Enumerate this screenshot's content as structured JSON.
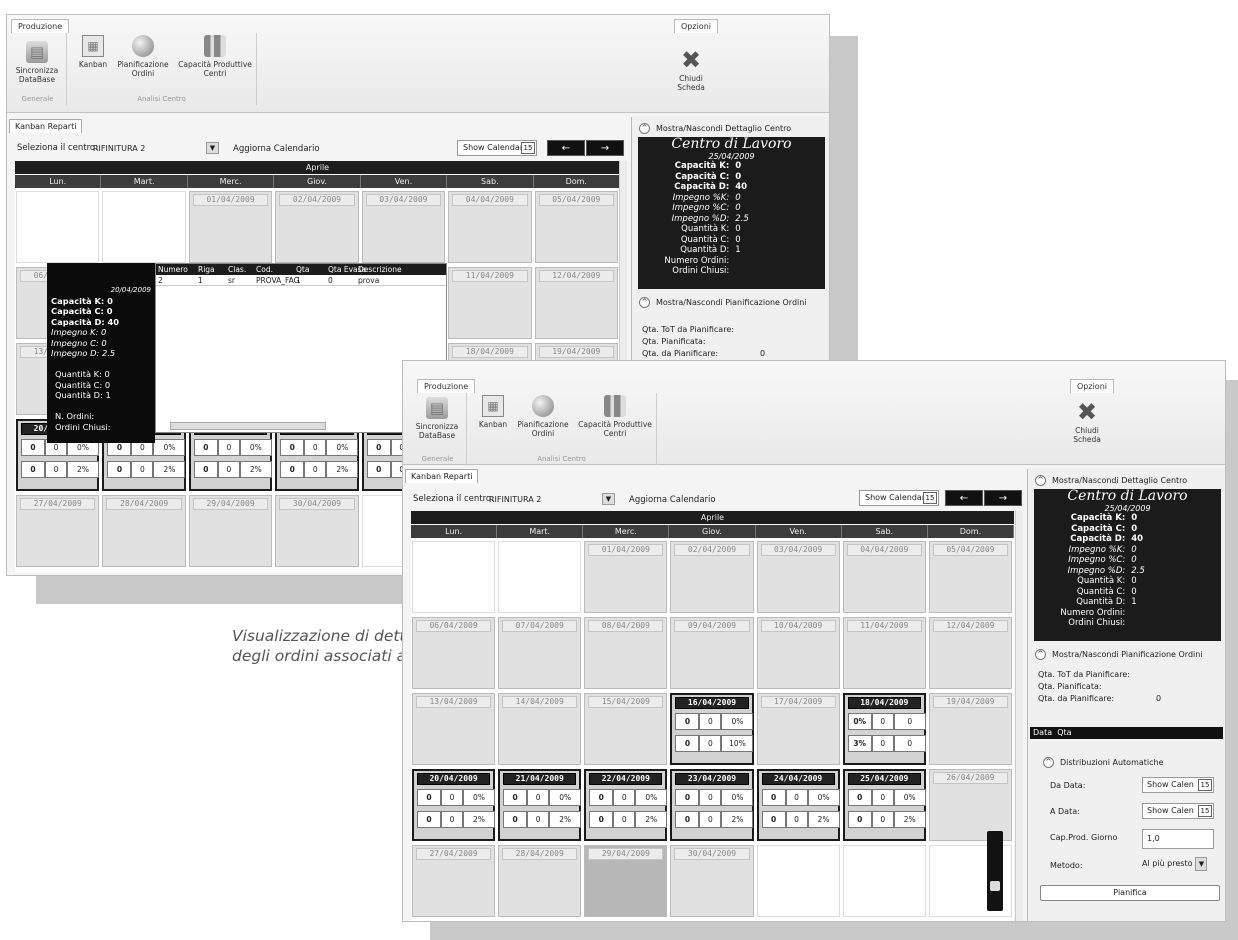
{
  "ribbon": {
    "tab_main": "Produzione",
    "tab_options": "Opzioni",
    "buttons": {
      "sync": "Sincronizza DataBase",
      "kanban": "Kanban",
      "plan": "Pianificazione Ordini",
      "cap": "Capacità Produttive Centri",
      "close": "Chiudi Scheda"
    },
    "groups": {
      "general": "Generale",
      "centri": "Analisi Centro"
    }
  },
  "kanban": {
    "tab": "Kanban Reparti",
    "select_label": "Seleziona il centro:",
    "select_value": "RIFINITURA 2",
    "update": "Aggiorna Calendario",
    "show_calendar": "Show Calendar",
    "cal_icon": "15",
    "prev": "←",
    "next": "→"
  },
  "calendar": {
    "month": "Aprile",
    "days": [
      "Lun.",
      "Mart.",
      "Merc.",
      "Giov.",
      "Ven.",
      "Sab.",
      "Dom."
    ],
    "weeks": [
      [
        "",
        "",
        "01/04/2009",
        "02/04/2009",
        "03/04/2009",
        "04/04/2009",
        "05/04/2009"
      ],
      [
        "06/04/2009",
        "07/04/2009",
        "08/04/2009",
        "09/04/2009",
        "10/04/2009",
        "11/04/2009",
        "12/04/2009"
      ],
      [
        "13/04/2009",
        "14/04/2009",
        "15/04/2009",
        "16/04/2009",
        "17/04/2009",
        "18/04/2009",
        "19/04/2009"
      ],
      [
        "20/04/2009",
        "21/04/2009",
        "22/04/2009",
        "23/04/2009",
        "24/04/2009",
        "25/04/2009",
        "26/04/2009"
      ],
      [
        "27/04/2009",
        "28/04/2009",
        "29/04/2009",
        "30/04/2009",
        "",
        "",
        ""
      ]
    ],
    "kanban_cells": {
      "16": [
        [
          "0",
          "0",
          "0%"
        ],
        [
          "0",
          "0",
          "10%"
        ]
      ],
      "18": [
        [
          "0%",
          "0",
          "0"
        ],
        [
          "3%",
          "0",
          "0"
        ]
      ],
      "std": [
        [
          "0",
          "0",
          "0%"
        ],
        [
          "0",
          "0",
          "2%"
        ]
      ]
    }
  },
  "centro": {
    "toggle": "Mostra/Nascondi Dettaglio Centro",
    "title": "Centro di Lavoro",
    "date": "25/04/2009",
    "rows": [
      {
        "k": "Capacità K:",
        "v": "0",
        "s": "b"
      },
      {
        "k": "Capacità C:",
        "v": "0",
        "s": "b"
      },
      {
        "k": "Capacità D:",
        "v": "40",
        "s": "b"
      },
      {
        "k": "Impegno %K:",
        "v": "0",
        "s": "i"
      },
      {
        "k": "Impegno %C:",
        "v": "0",
        "s": "i"
      },
      {
        "k": "Impegno %D:",
        "v": "2.5",
        "s": "i"
      },
      {
        "k": "Quantità K:",
        "v": "0",
        "s": ""
      },
      {
        "k": "Quantità C:",
        "v": "0",
        "s": ""
      },
      {
        "k": "Quantità D:",
        "v": "1",
        "s": ""
      },
      {
        "k": "Numero Ordini:",
        "v": "",
        "s": ""
      },
      {
        "k": "Ordini Chiusi:",
        "v": "",
        "s": ""
      }
    ]
  },
  "planning": {
    "toggle": "Mostra/Nascondi Pianificazione Ordini",
    "tot": "Qta. ToT da Pianificare:",
    "pian": "Qta. Pianificata:",
    "da": "Qta. da Pianificare:",
    "da_val": "0",
    "table_hdr": "Data  Qta",
    "auto": "Distribuzioni Automatiche",
    "da_data": "Da Data:",
    "a_data": "A Data:",
    "cap_giorno": "Cap.Prod. Giorno",
    "cap_val": "1,0",
    "metodo": "Metodo:",
    "metodo_val": "Al più presto",
    "show_cal_short": "Show Calen",
    "btn": "Pianifica"
  },
  "popup": {
    "date": "20/04/2009",
    "lines": [
      "Capacità K: 0",
      "Capacità C: 0",
      "Capacità D: 40",
      "Impegno K: 0",
      "Impegno C: 0",
      "Impegno D: 2.5",
      "",
      "Quantità K: 0",
      "Quantità C: 0",
      "Quantità D: 1",
      "",
      "N. Ordini:",
      "Ordini Chiusi:"
    ],
    "cols": [
      "Numero",
      "Riga",
      "Clas.",
      "Cod.",
      "Qta",
      "Qta Evasa",
      "Descrizione"
    ],
    "row": [
      "2",
      "1",
      "sr",
      "PROVA_FAG",
      "1",
      "0",
      "prova"
    ]
  },
  "caption": [
    "Visualizzazione di dettaglio",
    "degli ordini associati ad un giorno"
  ]
}
